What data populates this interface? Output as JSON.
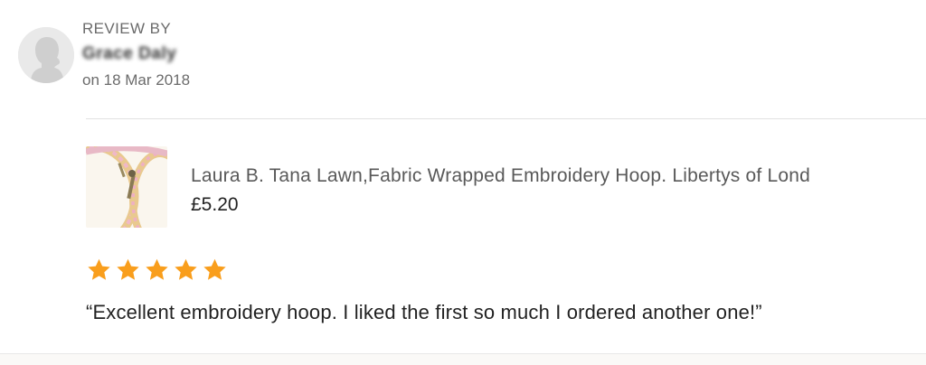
{
  "reviewer": {
    "heading": "REVIEW BY",
    "name": "Grace Daly",
    "date": "on 18 Mar 2018"
  },
  "product": {
    "title": "Laura B. Tana Lawn,Fabric Wrapped Embroidery Hoop. Libertys of Lond",
    "price": "£5.20"
  },
  "rating": {
    "stars": 5,
    "max": 5,
    "color": "#f99e1c"
  },
  "review": {
    "text": "“Excellent embroidery hoop. I liked the first so much I ordered another one!”"
  },
  "icons": {
    "avatar": "default-user-avatar-icon",
    "star": "star-icon"
  }
}
